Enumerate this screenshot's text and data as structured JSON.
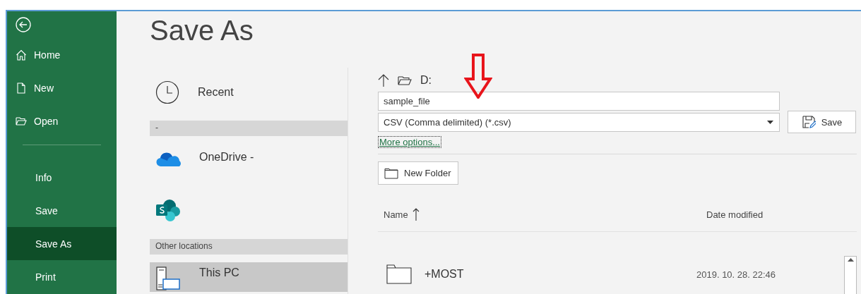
{
  "sidebar": {
    "items": [
      {
        "kind": "back",
        "selected": false
      },
      {
        "kind": "home",
        "label": "Home",
        "selected": false
      },
      {
        "kind": "new",
        "label": "New",
        "selected": false
      },
      {
        "kind": "open",
        "label": "Open",
        "selected": false
      },
      {
        "kind": "divider"
      },
      {
        "kind": "plain",
        "label": "Info",
        "selected": false
      },
      {
        "kind": "plain",
        "label": "Save",
        "selected": false
      },
      {
        "kind": "plain",
        "label": "Save As",
        "selected": true
      },
      {
        "kind": "plain",
        "label": "Print",
        "selected": false
      }
    ]
  },
  "title": "Save As",
  "locations": [
    {
      "kind": "recent",
      "label": "Recent",
      "selected": false
    },
    {
      "kind": "header",
      "label": "-"
    },
    {
      "kind": "onedrive",
      "label": "OneDrive -",
      "selected": false
    },
    {
      "kind": "sharepoint",
      "selected": false
    },
    {
      "kind": "header",
      "label": "Other locations"
    },
    {
      "kind": "pc",
      "label": "This PC",
      "selected": true
    }
  ],
  "path": "D:",
  "file_name": "sample_file",
  "file_type": "CSV (Comma delimited) (*.csv)",
  "save_button": "Save",
  "more_options": "More options...",
  "new_folder_button": "New Folder",
  "columns": [
    {
      "label": "Name",
      "sorted": true
    },
    {
      "label": "Date modified",
      "sorted": false
    }
  ],
  "rows": [
    {
      "name": "+MOST",
      "date": "2019. 10. 28. 22:46"
    }
  ]
}
